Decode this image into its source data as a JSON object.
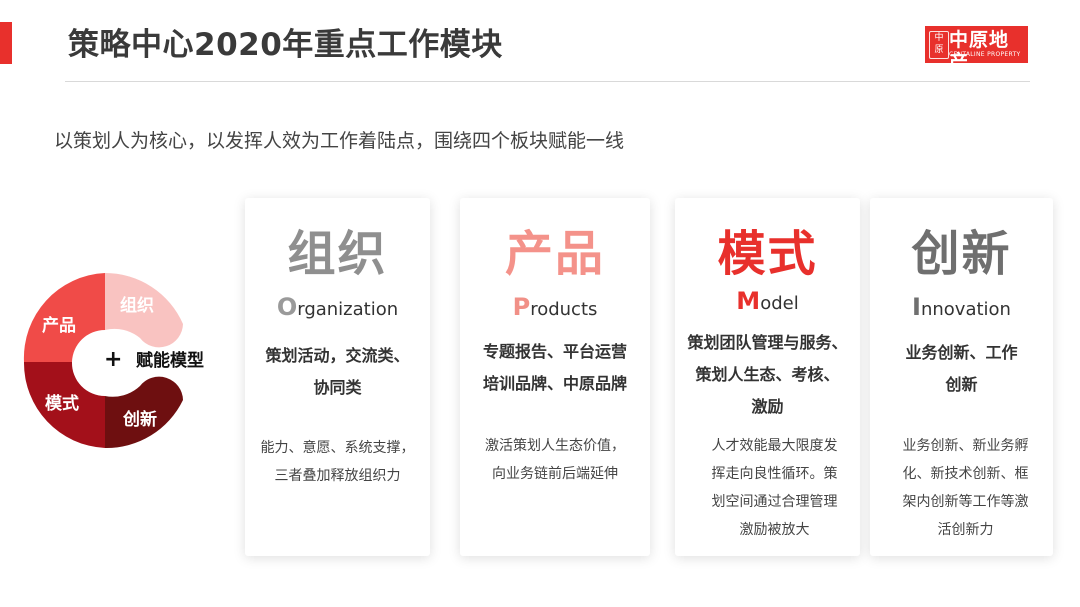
{
  "header": {
    "title": "策略中心2020年重点工作模块",
    "logo_cn": "中原地产",
    "logo_en": "CENTALINE PROPERTY",
    "accent_color": "#e8302c"
  },
  "subtitle": "以策划人为核心，以发挥人效为工作着陆点，围绕四个板块赋能一线",
  "wheel": {
    "center_symbol": "+",
    "center_label": "赋能模型",
    "segments": [
      {
        "label": "组织",
        "color": "#f9c3c1"
      },
      {
        "label": "产品",
        "color": "#f04b48"
      },
      {
        "label": "模式",
        "color": "#a3101a"
      },
      {
        "label": "创新",
        "color": "#6e0f10"
      }
    ]
  },
  "cards": [
    {
      "big": "组织",
      "en_first": "O",
      "en_rest": "rganization",
      "desc": [
        "策划活动，交流类、",
        "协同类"
      ],
      "detail": [
        "能力、意愿、系统支撑，",
        "三者叠加释放组织力"
      ]
    },
    {
      "big": "产品",
      "en_first": "P",
      "en_rest": "roducts",
      "desc": [
        "专题报告、平台运营",
        "培训品牌、中原品牌"
      ],
      "detail": [
        "激活策划人生态价值，",
        "向业务链前后端延伸"
      ]
    },
    {
      "big": "模式",
      "en_first": "M",
      "en_rest": "odel",
      "desc": [
        "策划团队管理与服务、",
        "策划人生态、考核、",
        "激励"
      ],
      "detail": [
        "人才效能最大限度发",
        "挥走向良性循环。策",
        "划空间通过合理管理",
        "激励被放大"
      ]
    },
    {
      "big": "创新",
      "en_first": "I",
      "en_rest": "nnovation",
      "desc": [
        "业务创新、工作",
        "创新"
      ],
      "detail": [
        "业务创新、新业务孵",
        "化、新技术创新、框",
        "架内创新等工作等激",
        "活创新力"
      ]
    }
  ]
}
